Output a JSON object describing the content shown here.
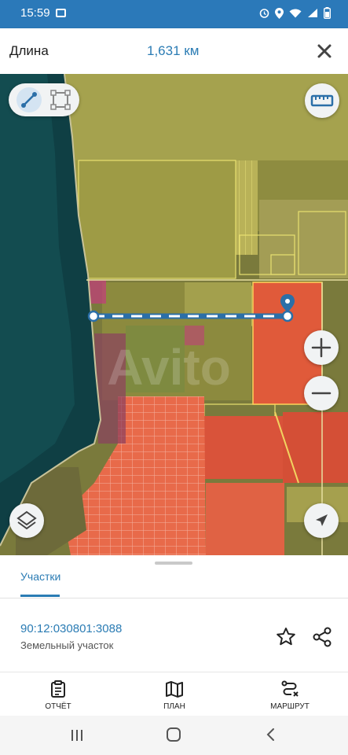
{
  "status_bar": {
    "time": "15:59",
    "icons": [
      "gallery-icon",
      "alarm-icon",
      "location-icon",
      "wifi-icon",
      "signal-icon",
      "battery-icon"
    ]
  },
  "header": {
    "title": "Длина",
    "measurement": "1,631 км",
    "close_icon": "close-icon"
  },
  "map": {
    "watermark": "Avito",
    "tools": [
      "line-measure-icon",
      "area-measure-icon"
    ],
    "controls": [
      "ruler-icon",
      "zoom-in-icon",
      "zoom-out-icon",
      "layers-icon",
      "locate-icon"
    ]
  },
  "panel": {
    "tab": "Участки",
    "parcel_id": "90:12:030801:3088",
    "parcel_type": "Земельный участок"
  },
  "bottom_nav": {
    "report": "ОТЧЁТ",
    "plan": "ПЛАН",
    "route": "МАРШРУТ"
  },
  "colors": {
    "accent": "#2b7cb4",
    "status_bar": "#2b79b9",
    "parcel_fill": "#e05a3a"
  }
}
